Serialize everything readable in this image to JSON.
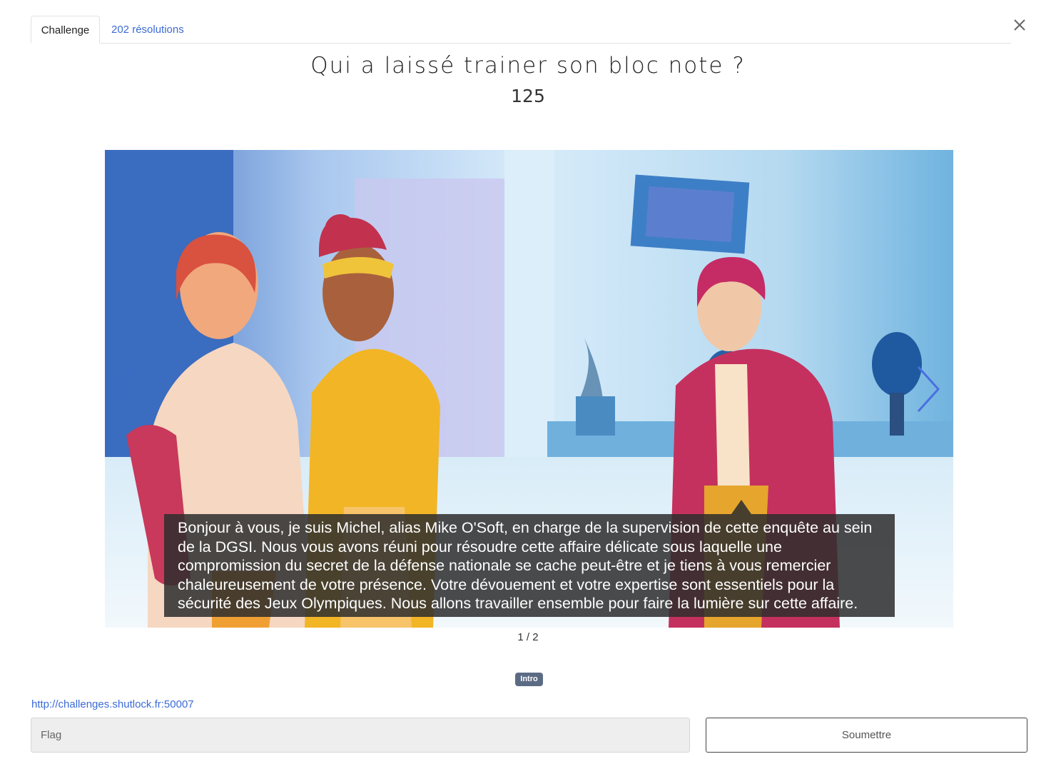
{
  "tabs": [
    {
      "label": "Challenge",
      "active": true
    },
    {
      "label": "202 résolutions",
      "active": false
    }
  ],
  "challenge": {
    "title": "Qui a laissé trainer son bloc note ?",
    "points": "125",
    "tag": "Intro",
    "link": "http://challenges.shutlock.fr:50007"
  },
  "carousel": {
    "caption": "Bonjour à vous, je suis Michel, alias Mike O'Soft, en charge de la supervision de cette enquête au sein de la DGSI. Nous vous avons réuni pour résoudre cette affaire délicate sous laquelle une compromission du secret de la défense nationale se cache peut-être et je tiens à vous remercier chaleureusement de votre présence. Votre dévouement et votre expertise sont essentiels pour la sécurité des Jeux Olympiques. Nous allons travailler ensemble pour faire la lumière sur cette affaire.",
    "counter": "1 / 2"
  },
  "form": {
    "flag_placeholder": "Flag",
    "submit_label": "Soumettre"
  },
  "icons": {
    "close": "close-icon",
    "next": "chevron-right-icon",
    "prev": "chevron-left-icon"
  },
  "colors": {
    "link": "#3b6bd6",
    "badge": "#5c6b84",
    "arrow": "#4a6fe0"
  }
}
